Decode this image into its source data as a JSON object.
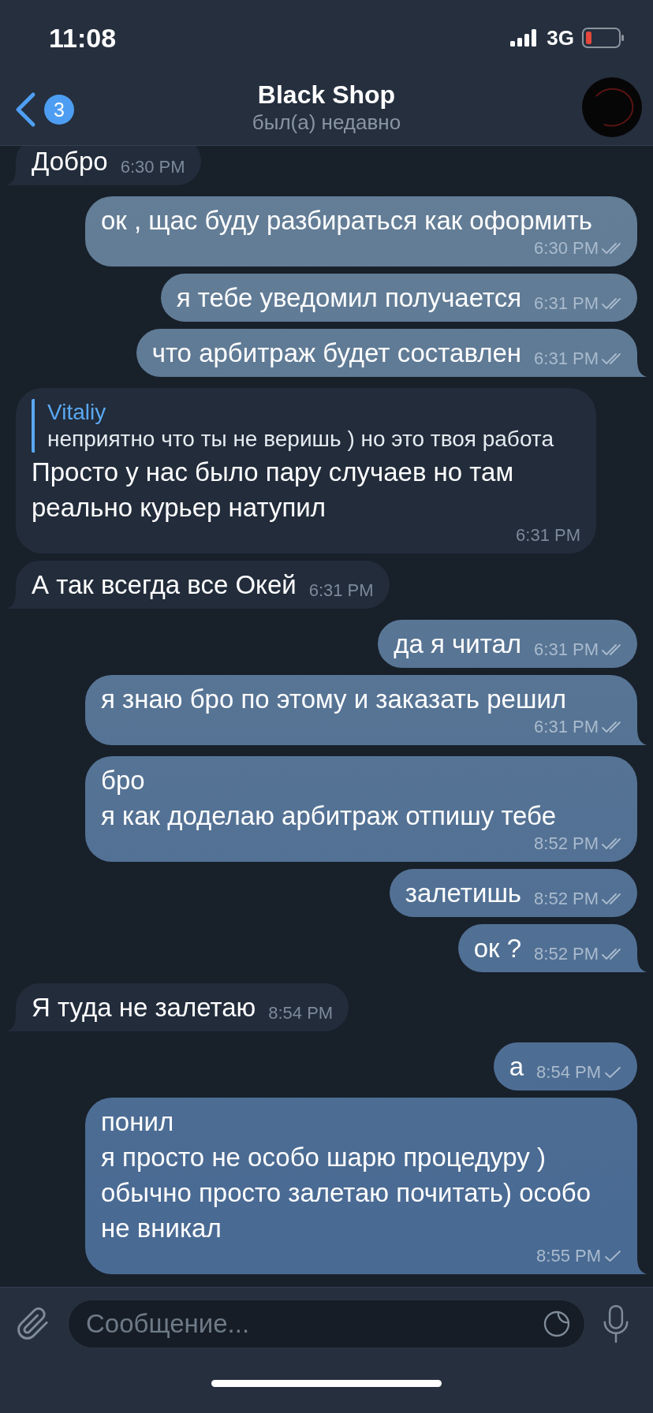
{
  "status_bar": {
    "time": "11:08",
    "network": "3G"
  },
  "header": {
    "back_badge": "3",
    "title": "Black Shop",
    "subtitle": "был(а) недавно"
  },
  "messages": [
    {
      "kind": "incoming",
      "text": "Добро",
      "time": "6:30 PM",
      "tail": true
    },
    {
      "kind": "outgoing",
      "text": "ок , щас буду разбираться как оформить",
      "time": "6:30 PM",
      "read": true,
      "tail": false
    },
    {
      "kind": "outgoing",
      "text": "я тебе уведомил получается",
      "time": "6:31 PM",
      "read": true,
      "tail": false
    },
    {
      "kind": "outgoing",
      "text": "что арбитраж будет составлен",
      "time": "6:31 PM",
      "read": true,
      "tail": true
    },
    {
      "kind": "incoming",
      "reply": {
        "author": "Vitaliy",
        "text": "неприятно что ты не веришь ) но это твоя работа"
      },
      "text": "Просто у нас было пару случаев но там реально курьер натупил",
      "time": "6:31 PM",
      "tail": false
    },
    {
      "kind": "incoming",
      "text": "А так всегда все Окей",
      "time": "6:31 PM",
      "tail": true
    },
    {
      "kind": "outgoing",
      "text": "да я читал",
      "time": "6:31 PM",
      "read": true,
      "tail": false
    },
    {
      "kind": "outgoing",
      "text": "я знаю бро по этому и заказать решил",
      "time": "6:31 PM",
      "read": true,
      "tail": true
    },
    {
      "kind": "outgoing",
      "text": "бро\nя как доделаю арбитраж отпишу тебе",
      "time": "8:52 PM",
      "read": true,
      "tail": false
    },
    {
      "kind": "outgoing",
      "text": "залетишь",
      "time": "8:52 PM",
      "read": true,
      "tail": false
    },
    {
      "kind": "outgoing",
      "text": "ок ?",
      "time": "8:52 PM",
      "read": true,
      "tail": true
    },
    {
      "kind": "incoming",
      "text": "Я туда не залетаю",
      "time": "8:54 PM",
      "tail": true
    },
    {
      "kind": "outgoing",
      "text": "а",
      "time": "8:54 PM",
      "read": false,
      "tail": false
    },
    {
      "kind": "outgoing",
      "text": "понил\nя просто не особо шарю процедуру )\nобычно просто залетаю почитать) особо не вникал",
      "time": "8:55 PM",
      "read": false,
      "tail": true
    }
  ],
  "composer": {
    "placeholder": "Сообщение..."
  }
}
